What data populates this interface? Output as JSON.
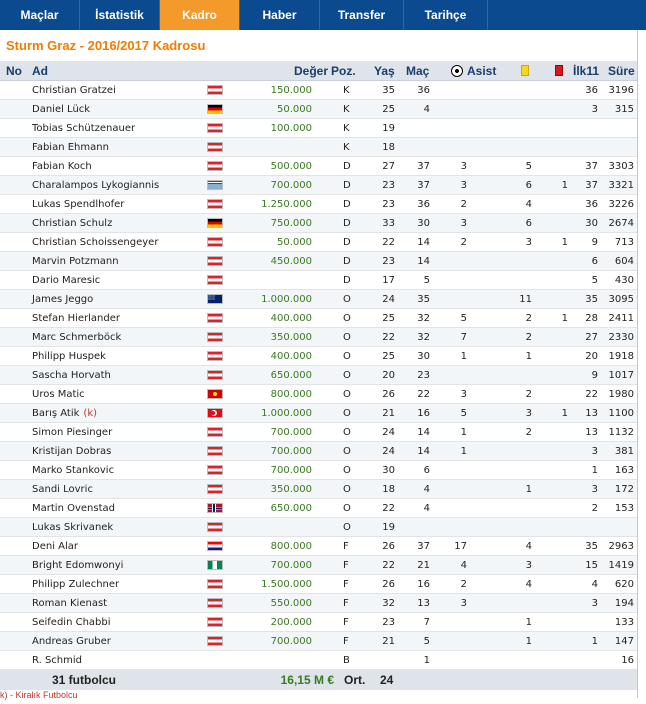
{
  "tabs": [
    {
      "label": "Maçlar",
      "active": false
    },
    {
      "label": "İstatistik",
      "active": false
    },
    {
      "label": "Kadro",
      "active": true
    },
    {
      "label": "Haber",
      "active": false
    },
    {
      "label": "Transfer",
      "active": false
    },
    {
      "label": "Tarihçe",
      "active": false
    }
  ],
  "page_title": "Sturm Graz - 2016/2017 Kadrosu",
  "columns": {
    "no": "No",
    "name": "Ad",
    "value": "Değer",
    "pos": "Poz.",
    "age": "Yaş",
    "matches": "Maç",
    "assists": "Asist",
    "starts": "İlk11",
    "minutes": "Süre"
  },
  "colors": {
    "tab_bar": "#0b4a8e",
    "tab_active": "#f39a2a",
    "title": "#f07d00",
    "value": "#3a7a1e",
    "loan": "#c0392b"
  },
  "players": [
    {
      "name": "Christian Gratzei",
      "flag": "aut",
      "value": "150.000",
      "pos": "K",
      "age": "35",
      "matches": "36",
      "assists": "",
      "yellow": "",
      "red": "",
      "starts": "36",
      "minutes": "3196"
    },
    {
      "name": "Daniel Lück",
      "flag": "ger",
      "value": "50.000",
      "pos": "K",
      "age": "25",
      "matches": "4",
      "assists": "",
      "yellow": "",
      "red": "",
      "starts": "3",
      "minutes": "315"
    },
    {
      "name": "Tobias Schützenauer",
      "flag": "aut",
      "value": "100.000",
      "pos": "K",
      "age": "19",
      "matches": "",
      "assists": "",
      "yellow": "",
      "red": "",
      "starts": "",
      "minutes": ""
    },
    {
      "name": "Fabian Ehmann",
      "flag": "aut",
      "value": "",
      "pos": "K",
      "age": "18",
      "matches": "",
      "assists": "",
      "yellow": "",
      "red": "",
      "starts": "",
      "minutes": ""
    },
    {
      "name": "Fabian Koch",
      "flag": "aut",
      "value": "500.000",
      "pos": "D",
      "age": "27",
      "matches": "37",
      "assists": "3",
      "yellow": "5",
      "red": "",
      "starts": "37",
      "minutes": "3303"
    },
    {
      "name": "Charalampos Lykogiannis",
      "flag": "gre",
      "value": "700.000",
      "pos": "D",
      "age": "23",
      "matches": "37",
      "assists": "3",
      "yellow": "6",
      "red": "1",
      "starts": "37",
      "minutes": "3321"
    },
    {
      "name": "Lukas Spendlhofer",
      "flag": "aut",
      "value": "1.250.000",
      "pos": "D",
      "age": "23",
      "matches": "36",
      "assists": "2",
      "yellow": "4",
      "red": "",
      "starts": "36",
      "minutes": "3226"
    },
    {
      "name": "Christian Schulz",
      "flag": "ger",
      "value": "750.000",
      "pos": "D",
      "age": "33",
      "matches": "30",
      "assists": "3",
      "yellow": "6",
      "red": "",
      "starts": "30",
      "minutes": "2674"
    },
    {
      "name": "Christian Schoissengeyer",
      "flag": "aut",
      "value": "50.000",
      "pos": "D",
      "age": "22",
      "matches": "14",
      "assists": "2",
      "yellow": "3",
      "red": "1",
      "starts": "9",
      "minutes": "713"
    },
    {
      "name": "Marvin Potzmann",
      "flag": "aut",
      "value": "450.000",
      "pos": "D",
      "age": "23",
      "matches": "14",
      "assists": "",
      "yellow": "",
      "red": "",
      "starts": "6",
      "minutes": "604"
    },
    {
      "name": "Dario Maresic",
      "flag": "aut",
      "value": "",
      "pos": "D",
      "age": "17",
      "matches": "5",
      "assists": "",
      "yellow": "",
      "red": "",
      "starts": "5",
      "minutes": "430"
    },
    {
      "name": "James Jeggo",
      "flag": "aus",
      "value": "1.000.000",
      "pos": "O",
      "age": "24",
      "matches": "35",
      "assists": "",
      "yellow": "11",
      "red": "",
      "starts": "35",
      "minutes": "3095"
    },
    {
      "name": "Stefan Hierlander",
      "flag": "aut",
      "value": "400.000",
      "pos": "O",
      "age": "25",
      "matches": "32",
      "assists": "5",
      "yellow": "2",
      "red": "1",
      "starts": "28",
      "minutes": "2411"
    },
    {
      "name": "Marc Schmerböck",
      "flag": "aut",
      "value": "350.000",
      "pos": "O",
      "age": "22",
      "matches": "32",
      "assists": "7",
      "yellow": "2",
      "red": "",
      "starts": "27",
      "minutes": "2330"
    },
    {
      "name": "Philipp Huspek",
      "flag": "aut",
      "value": "400.000",
      "pos": "O",
      "age": "25",
      "matches": "30",
      "assists": "1",
      "yellow": "1",
      "red": "",
      "starts": "20",
      "minutes": "1918"
    },
    {
      "name": "Sascha Horvath",
      "flag": "aut",
      "value": "650.000",
      "pos": "O",
      "age": "20",
      "matches": "23",
      "assists": "",
      "yellow": "",
      "red": "",
      "starts": "9",
      "minutes": "1017"
    },
    {
      "name": "Uros Matic",
      "flag": "mkd",
      "value": "800.000",
      "pos": "O",
      "age": "26",
      "matches": "22",
      "assists": "3",
      "yellow": "2",
      "red": "",
      "starts": "22",
      "minutes": "1980"
    },
    {
      "name": "Barış Atik",
      "loan": "(k)",
      "flag": "tur",
      "value": "1.000.000",
      "pos": "O",
      "age": "21",
      "matches": "16",
      "assists": "5",
      "yellow": "3",
      "red": "1",
      "starts": "13",
      "minutes": "1100"
    },
    {
      "name": "Simon Piesinger",
      "flag": "aut",
      "value": "700.000",
      "pos": "O",
      "age": "24",
      "matches": "14",
      "assists": "1",
      "yellow": "2",
      "red": "",
      "starts": "13",
      "minutes": "1132"
    },
    {
      "name": "Kristijan Dobras",
      "flag": "aut",
      "value": "700.000",
      "pos": "O",
      "age": "24",
      "matches": "14",
      "assists": "1",
      "yellow": "",
      "red": "",
      "starts": "3",
      "minutes": "381"
    },
    {
      "name": "Marko Stankovic",
      "flag": "aut",
      "value": "700.000",
      "pos": "O",
      "age": "30",
      "matches": "6",
      "assists": "",
      "yellow": "",
      "red": "",
      "starts": "1",
      "minutes": "163"
    },
    {
      "name": "Sandi Lovric",
      "flag": "aut",
      "value": "350.000",
      "pos": "O",
      "age": "18",
      "matches": "4",
      "assists": "",
      "yellow": "1",
      "red": "",
      "starts": "3",
      "minutes": "172"
    },
    {
      "name": "Martin Ovenstad",
      "flag": "nor",
      "value": "650.000",
      "pos": "O",
      "age": "22",
      "matches": "4",
      "assists": "",
      "yellow": "",
      "red": "",
      "starts": "2",
      "minutes": "153"
    },
    {
      "name": "Lukas Skrivanek",
      "flag": "aut",
      "value": "",
      "pos": "O",
      "age": "19",
      "matches": "",
      "assists": "",
      "yellow": "",
      "red": "",
      "starts": "",
      "minutes": ""
    },
    {
      "name": "Deni Alar",
      "flag": "cro",
      "value": "800.000",
      "pos": "F",
      "age": "26",
      "matches": "37",
      "assists": "17",
      "yellow": "4",
      "red": "",
      "starts": "35",
      "minutes": "2963"
    },
    {
      "name": "Bright Edomwonyi",
      "flag": "nga",
      "value": "700.000",
      "pos": "F",
      "age": "22",
      "matches": "21",
      "assists": "4",
      "yellow": "3",
      "red": "",
      "starts": "15",
      "minutes": "1419"
    },
    {
      "name": "Philipp Zulechner",
      "flag": "aut",
      "value": "1.500.000",
      "pos": "F",
      "age": "26",
      "matches": "16",
      "assists": "2",
      "yellow": "4",
      "red": "",
      "starts": "4",
      "minutes": "620"
    },
    {
      "name": "Roman Kienast",
      "flag": "aut",
      "value": "550.000",
      "pos": "F",
      "age": "32",
      "matches": "13",
      "assists": "3",
      "yellow": "",
      "red": "",
      "starts": "3",
      "minutes": "194"
    },
    {
      "name": "Seifedin Chabbi",
      "flag": "aut",
      "value": "200.000",
      "pos": "F",
      "age": "23",
      "matches": "7",
      "assists": "",
      "yellow": "1",
      "red": "",
      "starts": "",
      "minutes": "133"
    },
    {
      "name": "Andreas Gruber",
      "flag": "aut",
      "value": "700.000",
      "pos": "F",
      "age": "21",
      "matches": "5",
      "assists": "",
      "yellow": "1",
      "red": "",
      "starts": "1",
      "minutes": "147"
    },
    {
      "name": "R. Schmid",
      "flag": "",
      "value": "",
      "pos": "B",
      "age": "",
      "matches": "1",
      "assists": "",
      "yellow": "",
      "red": "",
      "starts": "",
      "minutes": "16"
    }
  ],
  "footer": {
    "total": "31 futbolcu",
    "value": "16,15 M €",
    "avg_label": "Ort.",
    "avg_age": "24"
  },
  "note": "k) - Kiralık Futbolcu"
}
